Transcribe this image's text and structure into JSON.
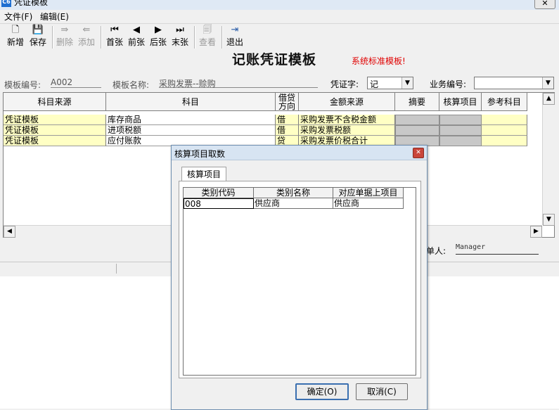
{
  "window": {
    "title": "凭证模板",
    "app_icon": "C6",
    "close_glyph": "✕"
  },
  "menu": [
    "文件(F)",
    "编辑(E)"
  ],
  "toolbar": [
    {
      "name": "new-button",
      "icon": "new-document-icon",
      "glyph": "🗋",
      "label": "新增",
      "enabled": true
    },
    {
      "name": "save-button",
      "icon": "floppy-disk-icon",
      "glyph": "💾",
      "label": "保存",
      "enabled": true
    },
    {
      "name": "delete-button",
      "icon": "delete-row-icon",
      "glyph": "⇛",
      "label": "删除",
      "enabled": false
    },
    {
      "name": "add-button",
      "icon": "add-row-icon",
      "glyph": "⇚",
      "label": "添加",
      "enabled": false
    },
    {
      "name": "first-button",
      "icon": "first-record-icon",
      "glyph": "⏮",
      "label": "首张",
      "enabled": true
    },
    {
      "name": "prev-button",
      "icon": "previous-record-icon",
      "glyph": "◀",
      "label": "前张",
      "enabled": true
    },
    {
      "name": "next-button",
      "icon": "next-record-icon",
      "glyph": "▶",
      "label": "后张",
      "enabled": true
    },
    {
      "name": "last-button",
      "icon": "last-record-icon",
      "glyph": "⏭",
      "label": "末张",
      "enabled": true
    },
    {
      "name": "view-button",
      "icon": "view-document-icon",
      "glyph": "🗐",
      "label": "查看",
      "enabled": false
    },
    {
      "name": "exit-button",
      "icon": "exit-door-icon",
      "glyph": "⇥",
      "label": "退出",
      "enabled": true
    }
  ],
  "header": {
    "doc_title": "记账凭证模板",
    "std_note": "系统标准模板!",
    "template_no_label": "模板编号:",
    "template_no": "A002",
    "template_name_label": "模板名称:",
    "template_name": "采购发票--赊购",
    "voucher_word_label": "凭证字:",
    "voucher_word": "记",
    "biz_no_label": "业务编号:",
    "biz_no": ""
  },
  "grid": {
    "columns": [
      "科目来源",
      "科目",
      "借贷\n方向",
      "金额来源",
      "摘要",
      "核算项目",
      "参考科目"
    ],
    "rows": [
      {
        "source": "凭证模板",
        "account": "库存商品",
        "dir": "借",
        "amount_source": "采购发票不含税金额"
      },
      {
        "source": "凭证模板",
        "account": "进项税额",
        "dir": "借",
        "amount_source": "采购发票税额"
      },
      {
        "source": "凭证模板",
        "account": "应付账款",
        "dir": "贷",
        "amount_source": "采购发票价税合计"
      }
    ]
  },
  "footer": {
    "maker_label": "单人:",
    "maker": "Manager"
  },
  "dialog": {
    "title": "核算项目取数",
    "close_glyph": "✕",
    "tab": "核算项目",
    "columns": [
      "类别代码",
      "类别名称",
      "对应单据上项目"
    ],
    "rows": [
      {
        "code": "008",
        "name": "供应商",
        "field": "供应商"
      }
    ],
    "ok_label": "确定(O)",
    "cancel_label": "取消(C)"
  },
  "colors": {
    "highlight_row": "#ffffc4",
    "note_red": "#e00000",
    "dialog_title": "#d7e4f2"
  }
}
